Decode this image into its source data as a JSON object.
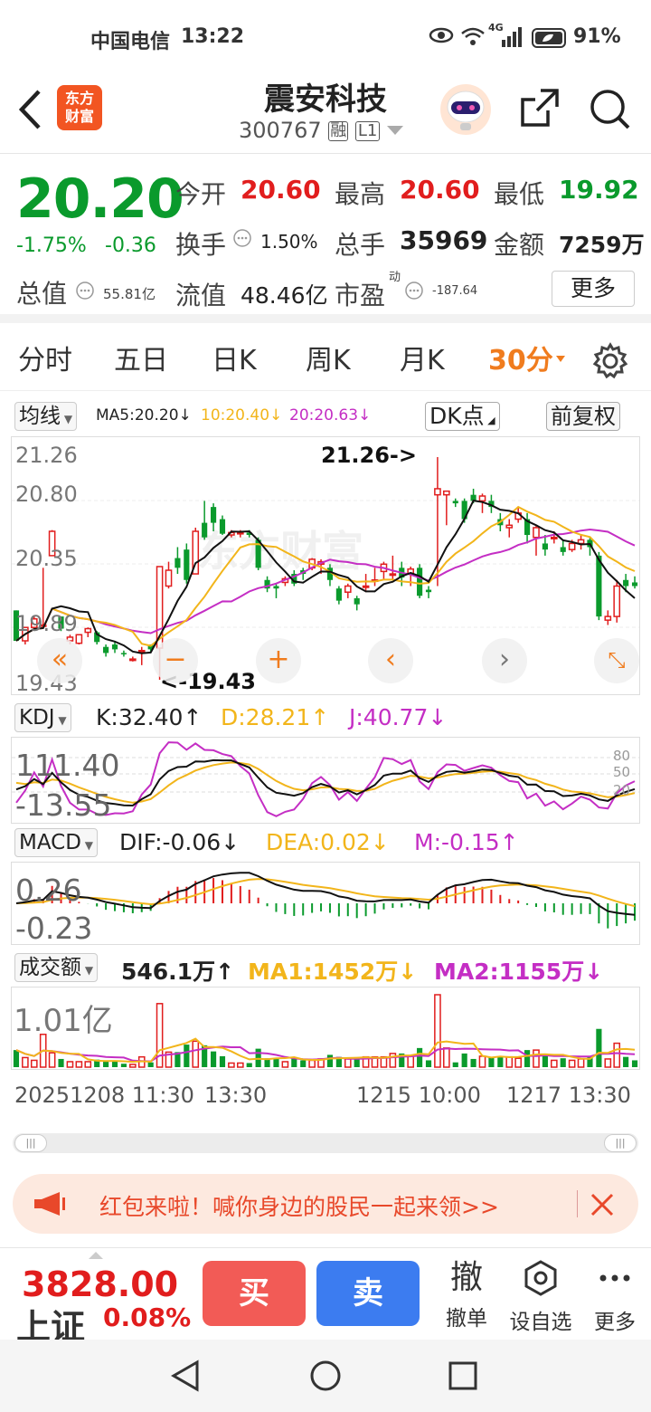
{
  "status": {
    "carrier": "中国电信",
    "time": "13:22",
    "net": "4G",
    "battery": "91%"
  },
  "header": {
    "name": "震安科技",
    "code": "300767",
    "margin_tag": "融",
    "level_tag": "L1",
    "logo": "东方\n财富",
    "logo1": "东方",
    "logo2": "财富"
  },
  "quote": {
    "price": "20.20",
    "pct": "-1.75%",
    "chg": "-0.36",
    "open_label": "今开",
    "open": "20.60",
    "high_label": "最高",
    "high": "20.60",
    "low_label": "最低",
    "low": "19.92",
    "turnover_label": "换手",
    "turnover": "1.50%",
    "vol_label": "总手",
    "vol": "35969",
    "amt_label": "金额",
    "amt": "7259万",
    "cap_label": "总值",
    "cap": "55.81亿",
    "float_label": "流值",
    "float": "48.46亿",
    "pe_label": "市盈",
    "pe_sup": "动",
    "pe": "-187.64",
    "more": "更多"
  },
  "tabs": [
    "分时",
    "五日",
    "日K",
    "周K",
    "月K"
  ],
  "tab_active": "30分",
  "ma": {
    "select": "均线",
    "ma5": "MA5:20.20↓",
    "ma10": "10:20.40↓",
    "ma20": "20:20.63↓",
    "dk": "DK点",
    "fq": "前复权"
  },
  "kline": {
    "y_labels": [
      "21.26",
      "20.80",
      "20.35",
      "19.89",
      "19.43"
    ],
    "high_note": "21.26->",
    "low_note": "<-19.43",
    "watermark": "东方财富"
  },
  "kdj": {
    "select": "KDJ",
    "k": "K:32.40↑",
    "d": "D:28.21↑",
    "j": "J:40.77↓",
    "top": "111.40",
    "bottom": "-13.55",
    "l80": "80",
    "l50": "50",
    "l20": "20"
  },
  "macd": {
    "select": "MACD",
    "dif": "DIF:-0.06↓",
    "dea": "DEA:0.02↓",
    "m": "M:-0.15↑",
    "top": "0.26",
    "bottom": "-0.23"
  },
  "vol": {
    "select": "成交额",
    "v": "546.1万↑",
    "ma1": "MA1:1452万↓",
    "ma2": "MA2:1155万↓",
    "top": "1.01亿"
  },
  "dates": [
    "20251208 11:30",
    "13:30",
    "1215 10:00",
    "1217 13:30"
  ],
  "banner": {
    "text": "红包来啦！喊你身边的股民一起来领>>"
  },
  "bottom": {
    "index_value": "3828.00",
    "index_name": "上证",
    "index_pct": "0.08%",
    "buy": "买",
    "sell": "卖",
    "cancel_icon": "撤",
    "cancel": "撤单",
    "custom": "设自选",
    "more": "更多"
  },
  "colors": {
    "up": "#e11d1d",
    "down": "#0a9a2c",
    "accent": "#f07c1e",
    "ma10": "#f2b51b",
    "ma20": "#c42ec4",
    "buy": "#f25b56",
    "sell": "#3c7cf0"
  },
  "chart_data": [
    {
      "type": "candlestick",
      "title": "30分",
      "y_range": [
        19.43,
        21.26
      ],
      "series": [
        {
          "name": "MA5",
          "value": 20.2
        },
        {
          "name": "MA10",
          "value": 20.4
        },
        {
          "name": "MA20",
          "value": 20.63
        }
      ],
      "candles": [
        [
          20.0,
          19.75,
          20.0,
          19.75
        ],
        [
          19.75,
          19.86,
          19.86,
          19.72
        ],
        [
          19.86,
          19.93,
          19.95,
          19.85
        ],
        [
          19.88,
          19.88,
          20.35,
          19.87
        ],
        [
          20.45,
          20.65,
          20.66,
          20.45
        ],
        [
          19.95,
          19.85,
          19.95,
          19.83
        ],
        [
          19.75,
          19.78,
          19.8,
          19.72
        ],
        [
          19.73,
          19.8,
          19.8,
          19.72
        ],
        [
          19.82,
          19.85,
          19.86,
          19.78
        ],
        [
          19.82,
          19.74,
          19.83,
          19.72
        ],
        [
          19.7,
          19.65,
          19.72,
          19.62
        ],
        [
          19.72,
          19.68,
          19.74,
          19.65
        ],
        [
          19.65,
          19.64,
          19.67,
          19.62
        ],
        [
          19.6,
          19.6,
          19.62,
          19.58
        ],
        [
          19.66,
          19.67,
          19.7,
          19.55
        ],
        [
          19.72,
          19.68,
          19.72,
          19.65
        ],
        [
          19.69,
          20.36,
          20.36,
          19.43
        ],
        [
          20.2,
          20.33,
          20.4,
          20.18
        ],
        [
          20.43,
          20.35,
          20.52,
          20.3
        ],
        [
          20.5,
          20.25,
          20.55,
          20.22
        ],
        [
          20.3,
          20.65,
          20.68,
          20.3
        ],
        [
          20.72,
          20.6,
          20.9,
          20.58
        ],
        [
          20.85,
          20.72,
          20.88,
          20.65
        ],
        [
          20.75,
          20.63,
          20.78,
          20.62
        ],
        [
          20.62,
          20.64,
          20.66,
          20.6
        ],
        [
          20.63,
          20.64,
          20.66,
          20.6
        ],
        [
          20.64,
          20.62,
          20.66,
          20.6
        ],
        [
          20.58,
          20.35,
          20.6,
          20.33
        ],
        [
          20.25,
          20.18,
          20.28,
          20.15
        ],
        [
          20.2,
          20.18,
          20.22,
          20.1
        ],
        [
          20.23,
          20.26,
          20.28,
          20.2
        ],
        [
          20.3,
          20.22,
          20.33,
          20.2
        ],
        [
          20.33,
          20.3,
          20.35,
          20.25
        ],
        [
          20.35,
          20.42,
          20.43,
          20.33
        ],
        [
          20.38,
          20.4,
          20.42,
          20.3
        ],
        [
          20.35,
          20.25,
          20.38,
          20.2
        ],
        [
          20.18,
          20.08,
          20.2,
          20.05
        ],
        [
          20.15,
          20.2,
          20.22,
          20.1
        ],
        [
          20.1,
          20.05,
          20.12,
          20.0
        ],
        [
          20.2,
          20.2,
          20.3,
          20.15
        ],
        [
          20.25,
          20.25,
          20.35,
          20.2
        ],
        [
          20.32,
          20.38,
          20.4,
          20.25
        ],
        [
          20.3,
          20.3,
          20.45,
          20.25
        ],
        [
          20.35,
          20.27,
          20.4,
          20.2
        ],
        [
          20.3,
          20.34,
          20.36,
          20.2
        ],
        [
          20.35,
          20.12,
          20.38,
          20.1
        ],
        [
          20.17,
          20.15,
          20.2,
          20.1
        ],
        [
          20.95,
          21.0,
          21.26,
          20.2
        ],
        [
          20.95,
          20.98,
          20.98,
          20.7
        ],
        [
          20.9,
          20.88,
          20.92,
          20.85
        ],
        [
          20.9,
          20.75,
          20.92,
          20.72
        ],
        [
          20.95,
          20.9,
          21.0,
          20.88
        ],
        [
          20.9,
          20.94,
          20.96,
          20.8
        ],
        [
          20.9,
          20.85,
          20.95,
          20.8
        ],
        [
          20.75,
          20.7,
          20.8,
          20.65
        ],
        [
          20.68,
          20.7,
          20.75,
          20.6
        ],
        [
          20.75,
          20.8,
          20.85,
          20.72
        ],
        [
          20.75,
          20.62,
          20.8,
          20.55
        ],
        [
          20.6,
          20.68,
          20.7,
          20.45
        ],
        [
          20.55,
          20.5,
          20.62,
          20.45
        ],
        [
          20.6,
          20.6,
          20.65,
          20.55
        ],
        [
          20.52,
          20.48,
          20.58,
          20.45
        ],
        [
          20.5,
          20.55,
          20.58,
          20.48
        ],
        [
          20.55,
          20.58,
          20.62,
          20.5
        ],
        [
          20.58,
          20.52,
          20.6,
          20.45
        ],
        [
          20.45,
          19.95,
          20.48,
          19.92
        ],
        [
          19.92,
          19.95,
          20.0,
          19.88
        ],
        [
          19.95,
          20.2,
          20.25,
          19.9
        ],
        [
          20.25,
          20.2,
          20.3,
          20.15
        ],
        [
          20.23,
          20.2,
          20.28,
          20.18
        ]
      ]
    },
    {
      "type": "line",
      "title": "KDJ",
      "series": [
        {
          "name": "K",
          "value": 32.4
        },
        {
          "name": "D",
          "value": 28.21
        },
        {
          "name": "J",
          "value": 40.77
        }
      ],
      "y_range": [
        -13.55,
        111.4
      ]
    },
    {
      "type": "bar",
      "title": "MACD",
      "series": [
        {
          "name": "DIF",
          "value": -0.06
        },
        {
          "name": "DEA",
          "value": 0.02
        },
        {
          "name": "M",
          "value": -0.15
        }
      ],
      "y_range": [
        -0.23,
        0.26
      ]
    },
    {
      "type": "bar",
      "title": "成交额",
      "series": [
        {
          "name": "成交额",
          "value": "546.1万"
        },
        {
          "name": "MA1",
          "value": "1452万"
        },
        {
          "name": "MA2",
          "value": "1155万"
        }
      ],
      "y_max": "1.01亿"
    }
  ]
}
